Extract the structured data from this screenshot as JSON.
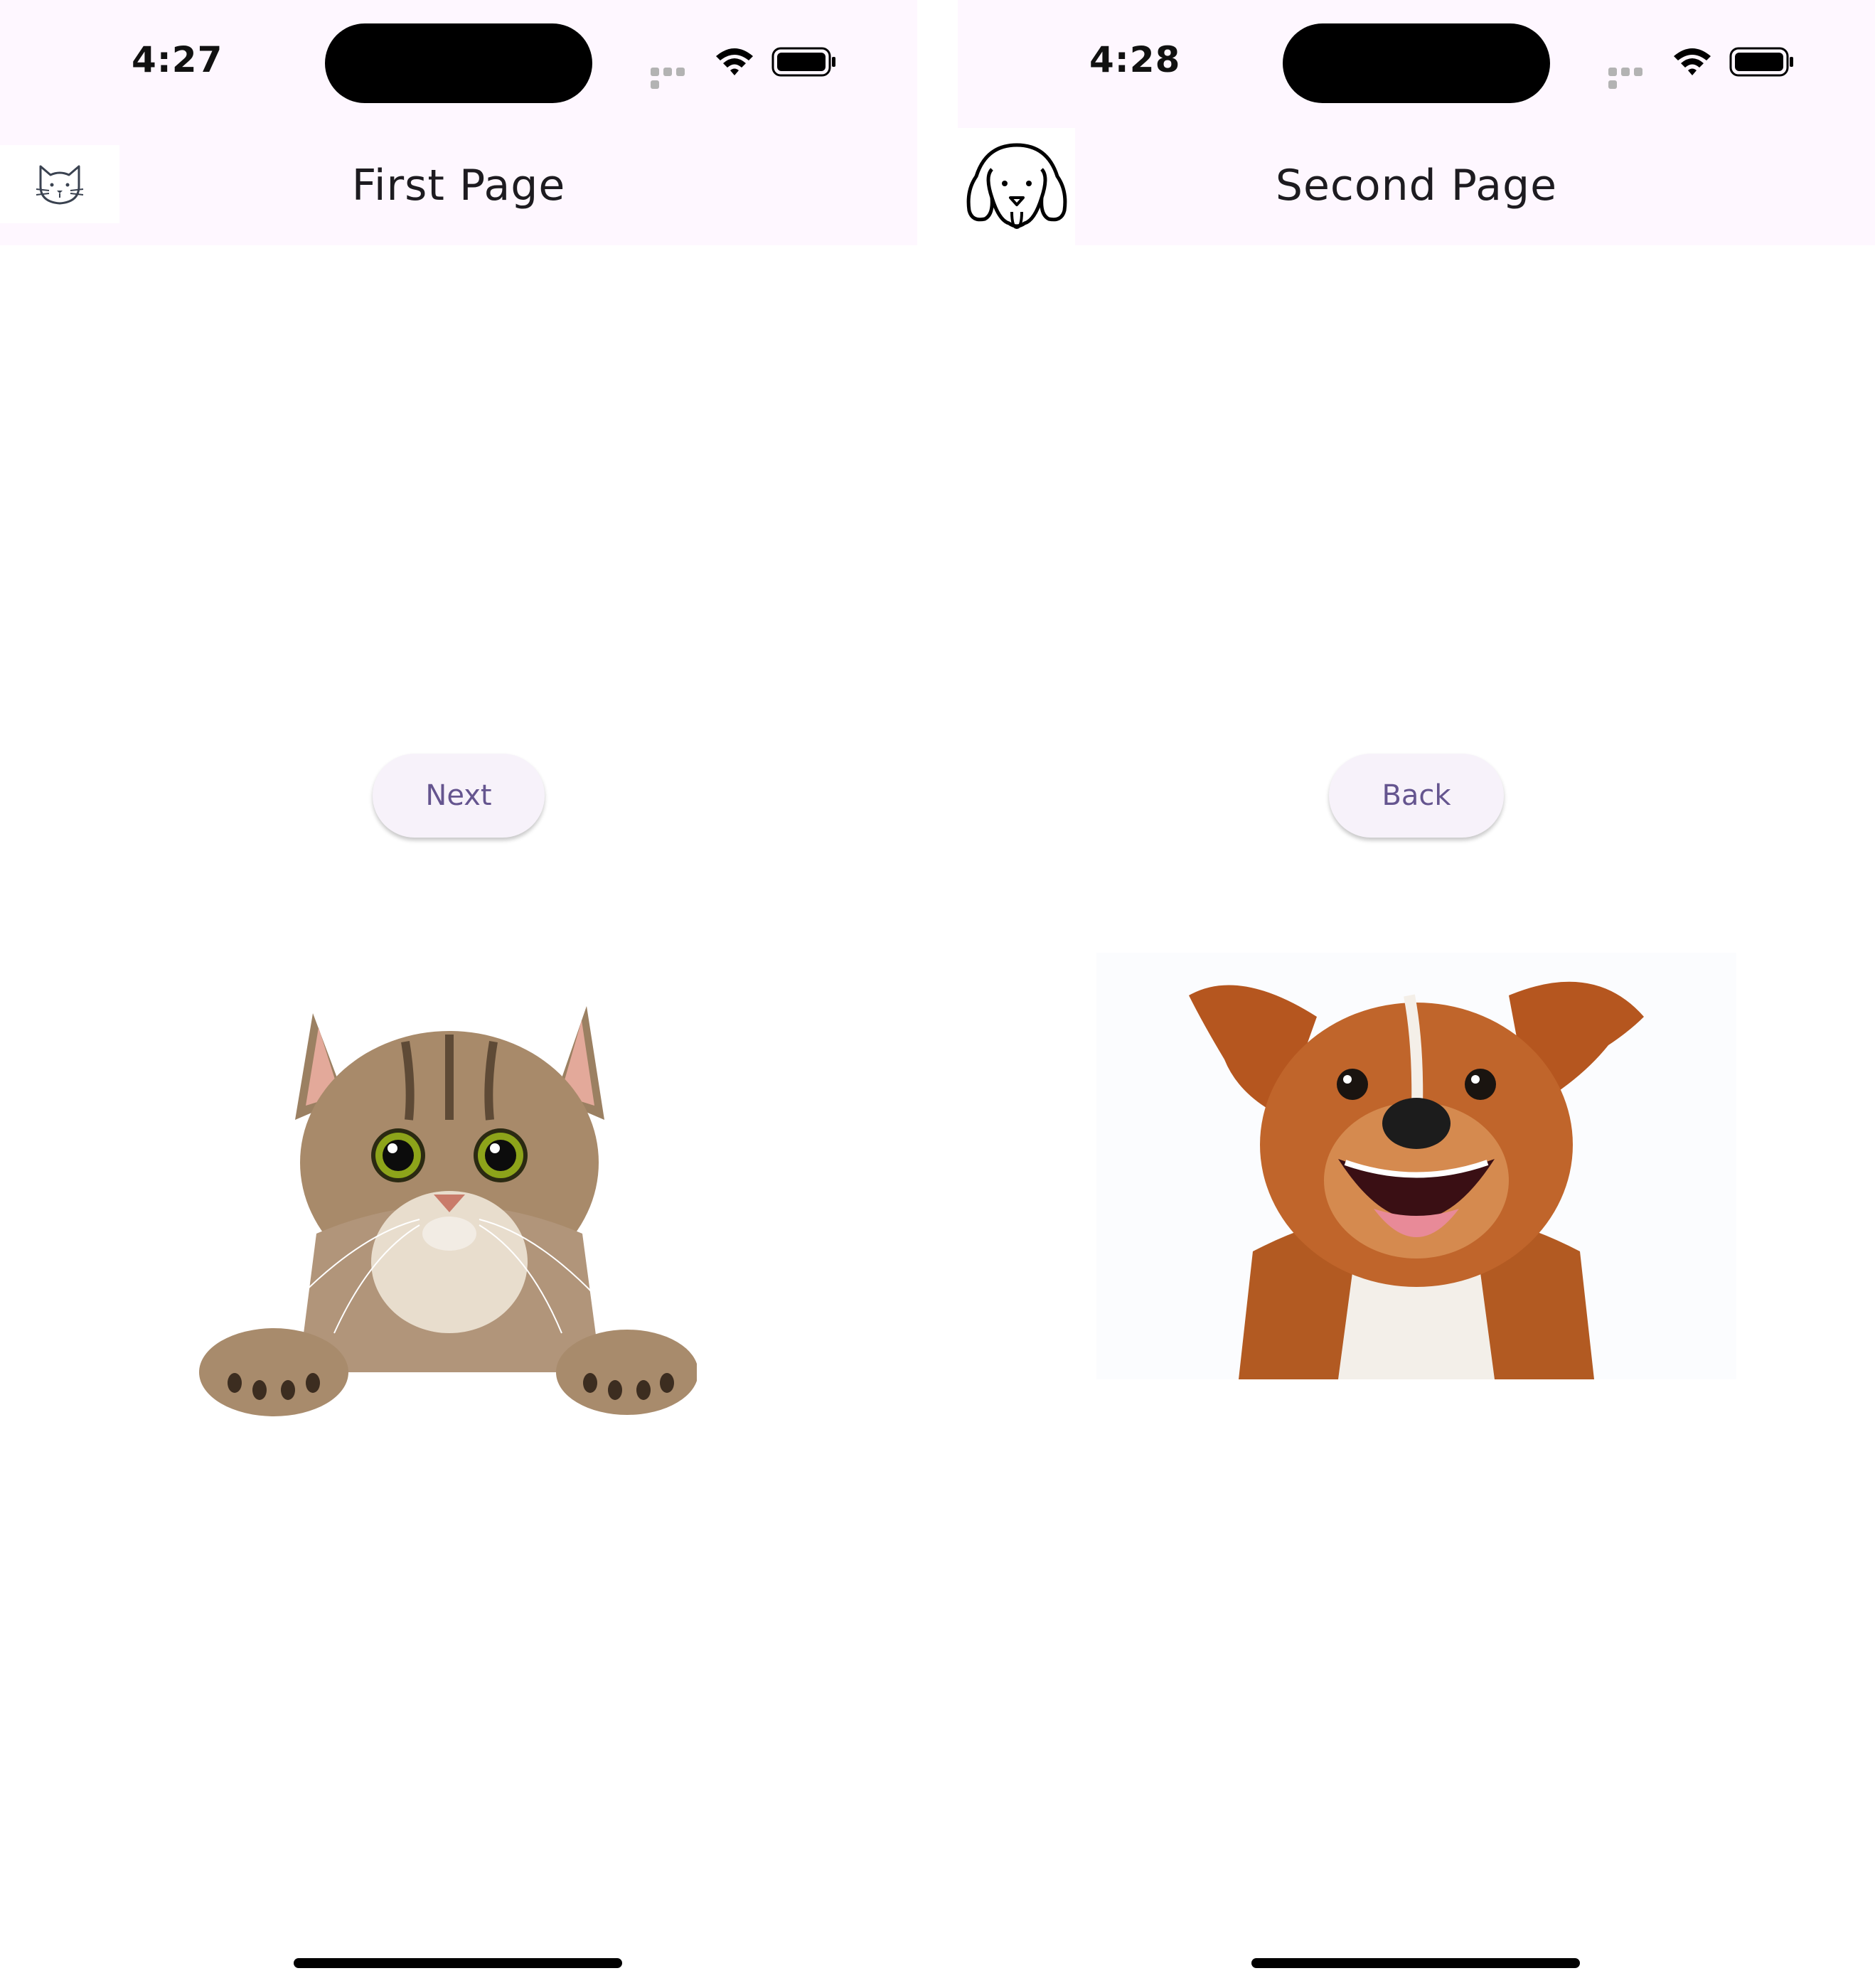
{
  "screens": [
    {
      "status": {
        "time": "4:27"
      },
      "appbar": {
        "title": "First Page",
        "leading_icon": "cat-face-icon"
      },
      "button": {
        "label": "Next"
      },
      "image": {
        "subject": "cat-photo"
      }
    },
    {
      "status": {
        "time": "4:28"
      },
      "appbar": {
        "title": "Second Page",
        "leading_icon": "dog-face-icon"
      },
      "button": {
        "label": "Back"
      },
      "image": {
        "subject": "dog-photo"
      }
    }
  ],
  "colors": {
    "appbar_bg": "#fef7ff",
    "button_bg": "#f7f2fa",
    "button_text": "#65558f",
    "title_text": "#1d1b20"
  }
}
